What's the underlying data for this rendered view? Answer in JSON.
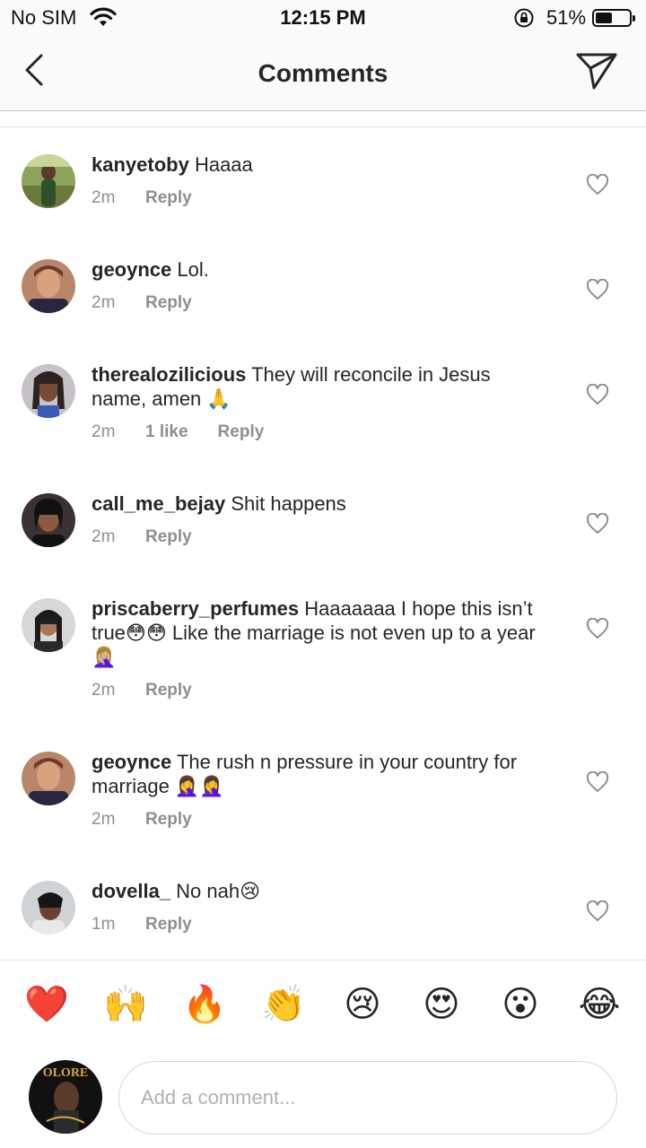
{
  "status_bar": {
    "carrier": "No SIM",
    "time": "12:15 PM",
    "battery_percent": "51%",
    "battery_level": 0.51
  },
  "nav": {
    "title": "Comments",
    "back_icon": "chevron-left-icon",
    "send_icon": "paper-plane-icon"
  },
  "comments": [
    {
      "username": "kanyetoby",
      "text": "Haaaa",
      "time": "2m",
      "likes": "",
      "reply": "Reply"
    },
    {
      "username": "geoynce",
      "text": "Lol.",
      "time": "2m",
      "likes": "",
      "reply": "Reply"
    },
    {
      "username": "therealozilicious",
      "text": "They will reconcile in Jesus name, amen 🙏",
      "time": "2m",
      "likes": "1 like",
      "reply": "Reply"
    },
    {
      "username": "call_me_bejay",
      "text": "Shit happens",
      "time": "2m",
      "likes": "",
      "reply": "Reply"
    },
    {
      "username": "priscaberry_perfumes",
      "text": "Haaaaaaa I hope this isn’t true😳😳 Like the marriage is not even up to a year🤦🏼‍♀️",
      "time": "2m",
      "likes": "",
      "reply": "Reply"
    },
    {
      "username": "geoynce",
      "text": "The rush n pressure in your country for marriage 🤦‍♀️🤦‍♀️",
      "time": "2m",
      "likes": "",
      "reply": "Reply"
    },
    {
      "username": "dovella_",
      "text": "No nah😢",
      "time": "1m",
      "likes": "",
      "reply": "Reply"
    }
  ],
  "emoji_bar": [
    "❤️",
    "🙌",
    "🔥",
    "👏",
    "😢",
    "😍",
    "😮",
    "😂"
  ],
  "composer": {
    "placeholder": "Add a comment...",
    "avatar_text": "OLORE"
  }
}
